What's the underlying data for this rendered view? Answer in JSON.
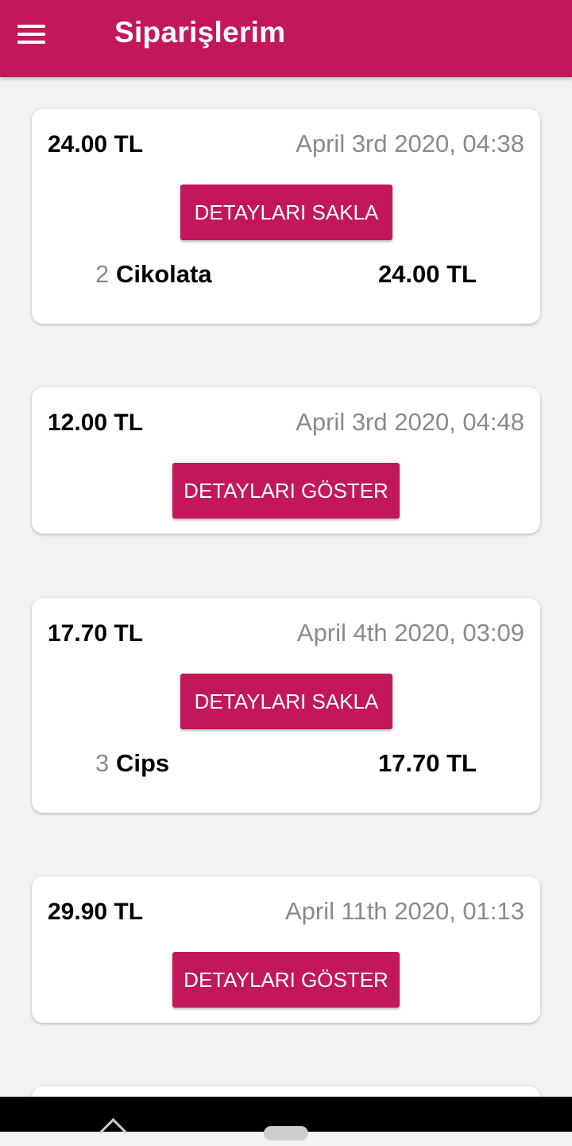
{
  "app_bar": {
    "title": "Siparişlerim",
    "menu_icon": "hamburger-menu-icon"
  },
  "orders": [
    {
      "total": "24.00 TL",
      "date": "April 3rd 2020, 04:38",
      "button_label": "DETAYLARI SAKLA",
      "expanded": true,
      "item": {
        "qty": "2",
        "name": "Cikolata",
        "price": "24.00 TL"
      }
    },
    {
      "total": "12.00 TL",
      "date": "April 3rd 2020, 04:48",
      "button_label": "DETAYLARI GÖSTER",
      "expanded": false
    },
    {
      "total": "17.70 TL",
      "date": "April 4th 2020, 03:09",
      "button_label": "DETAYLARI SAKLA",
      "expanded": true,
      "item": {
        "qty": "3",
        "name": "Cips",
        "price": "17.70 TL"
      }
    },
    {
      "total": "29.90 TL",
      "date": "April 11th 2020, 01:13",
      "button_label": "DETAYLARI GÖSTER",
      "expanded": false
    }
  ],
  "colors": {
    "primary": "#c2185b",
    "background": "#f2f2f2",
    "muted_text": "#8a8a8a"
  },
  "nav_bar": {
    "back_icon": "back-icon",
    "home_icon": "home-pill-icon"
  }
}
